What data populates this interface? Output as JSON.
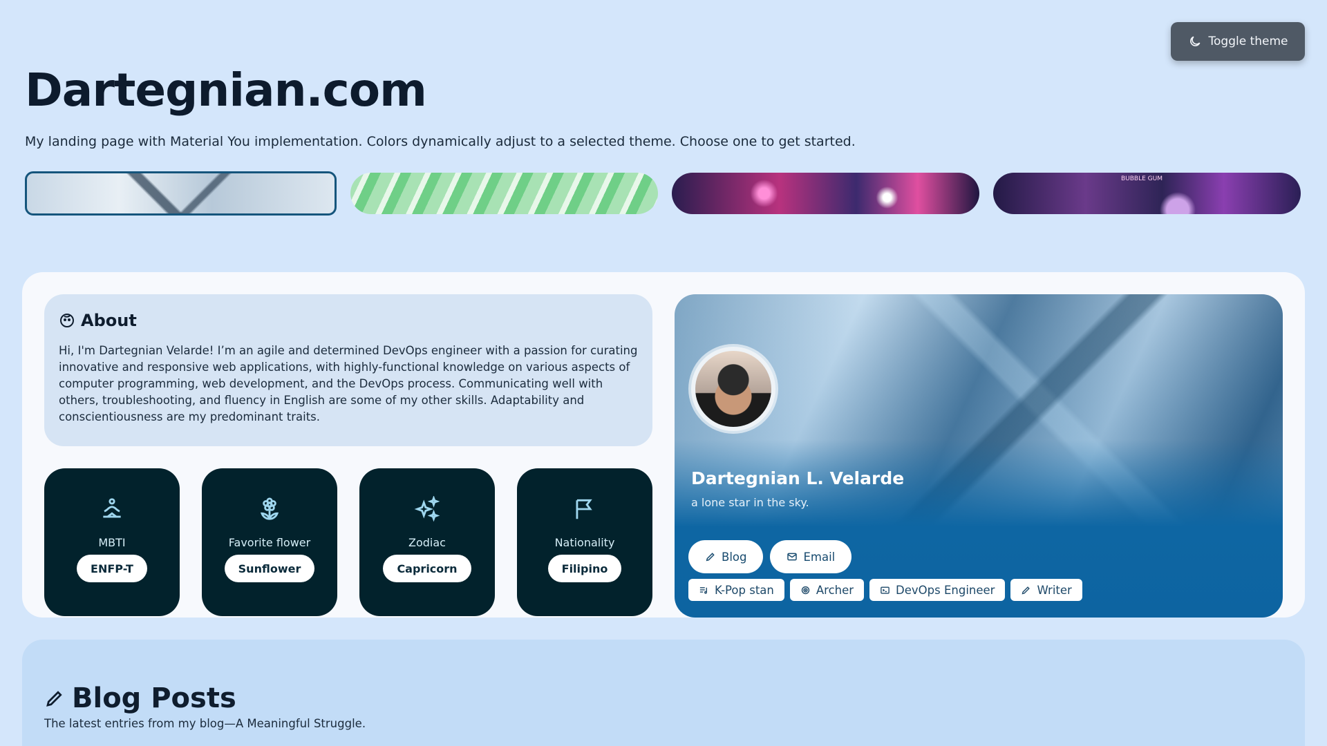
{
  "header": {
    "toggle_label": "Toggle theme",
    "title": "Dartegnian.com",
    "subtitle": "My landing page with Material You implementation. Colors dynamically adjust to a selected theme. Choose one to get started."
  },
  "themes": {
    "selected_index": 0,
    "bubble_gum_sign": "BUBBLE GUM"
  },
  "about": {
    "title": "About",
    "text": "Hi, I'm Dartegnian Velarde! I’m an agile and determined DevOps engineer with a passion for curating innovative and responsive web applications, with highly-functional knowledge on various aspects of computer programming, web development, and the DevOps process. Communicating well with others, troubleshooting, and fluency in English are some of my other skills. Adaptability and conscientiousness are my predominant traits."
  },
  "traits": [
    {
      "label": "MBTI",
      "value": "ENFP-T",
      "icon": "meditation-icon"
    },
    {
      "label": "Favorite flower",
      "value": "Sunflower",
      "icon": "flower-icon"
    },
    {
      "label": "Zodiac",
      "value": "Capricorn",
      "icon": "sparkles-icon"
    },
    {
      "label": "Nationality",
      "value": "Filipino",
      "icon": "flag-icon"
    }
  ],
  "profile": {
    "name": "Dartegnian L. Velarde",
    "tagline": "a lone star in the sky.",
    "actions": [
      {
        "label": "Blog",
        "icon": "pencil-icon"
      },
      {
        "label": "Email",
        "icon": "mail-icon"
      }
    ],
    "chips": [
      {
        "label": "K-Pop stan",
        "icon": "music-list-icon"
      },
      {
        "label": "Archer",
        "icon": "target-icon"
      },
      {
        "label": "DevOps Engineer",
        "icon": "terminal-icon"
      },
      {
        "label": "Writer",
        "icon": "pencil-icon"
      }
    ]
  },
  "blog": {
    "title": "Blog Posts",
    "subtitle": "The latest entries from my blog—A Meaningful Struggle."
  },
  "colors": {
    "background": "#d4e6fb",
    "trait_card": "#02222c",
    "profile_blue": "#0e66a3",
    "selected_border": "#15557c"
  }
}
